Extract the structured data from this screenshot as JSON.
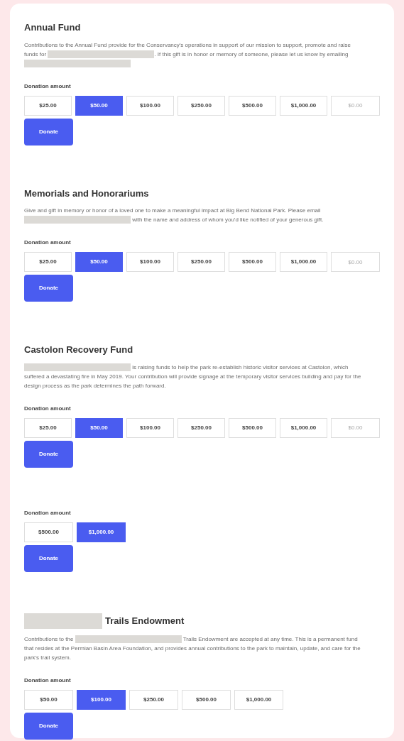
{
  "sections": [
    {
      "title": [
        {
          "kind": "text",
          "text": "Annual Fund"
        }
      ],
      "description": [
        {
          "kind": "text",
          "text": "Contributions to the Annual Fund provide for the Conservancy's operations in support of our mission to support, promote and raise funds for "
        },
        {
          "kind": "redacted"
        },
        {
          "kind": "text",
          "text": ". If this gift is in honor or memory of someone, please let us know by emailing"
        },
        {
          "kind": "redacted"
        }
      ],
      "amount_label": "Donation amount",
      "amounts": [
        {
          "label": "$25.00",
          "selected": false
        },
        {
          "label": "$50.00",
          "selected": true
        },
        {
          "label": "$100.00",
          "selected": false
        },
        {
          "label": "$250.00",
          "selected": false
        },
        {
          "label": "$500.00",
          "selected": false
        },
        {
          "label": "$1,000.00",
          "selected": false
        }
      ],
      "other_amount": {
        "placeholder": "$0.00"
      },
      "donate_button": "Donate"
    },
    {
      "title": [
        {
          "kind": "text",
          "text": "Memorials and Honorariums"
        }
      ],
      "description": [
        {
          "kind": "text",
          "text": "Give and gift in memory or honor of a loved one to make a meaningful impact at Big Bend National Park. Please email "
        },
        {
          "kind": "redacted"
        },
        {
          "kind": "text",
          "text": " with the name and address of whom you'd like notified of your generous gift."
        }
      ],
      "amount_label": "Donation amount",
      "amounts": [
        {
          "label": "$25.00",
          "selected": false
        },
        {
          "label": "$50.00",
          "selected": true
        },
        {
          "label": "$100.00",
          "selected": false
        },
        {
          "label": "$250.00",
          "selected": false
        },
        {
          "label": "$500.00",
          "selected": false
        },
        {
          "label": "$1,000.00",
          "selected": false
        }
      ],
      "other_amount": {
        "placeholder": "$0.00"
      },
      "donate_button": "Donate"
    },
    {
      "title": [
        {
          "kind": "text",
          "text": "Castolon Recovery Fund"
        }
      ],
      "description": [
        {
          "kind": "redacted"
        },
        {
          "kind": "text",
          "text": " is raising funds to help the park re-establish historic visitor services at Castolon, which suffered a devastating fire in May 2019. Your contribution will provide signage at the temporary visitor services building and pay for the design process as the park determines the path forward."
        }
      ],
      "amount_label": "Donation amount",
      "amounts": [
        {
          "label": "$25.00",
          "selected": false
        },
        {
          "label": "$50.00",
          "selected": true
        },
        {
          "label": "$100.00",
          "selected": false
        },
        {
          "label": "$250.00",
          "selected": false
        },
        {
          "label": "$500.00",
          "selected": false
        },
        {
          "label": "$1,000.00",
          "selected": false
        }
      ],
      "other_amount": {
        "placeholder": "$0.00"
      },
      "donate_button": "Donate"
    },
    {
      "amount_label": "Donation amount",
      "amounts": [
        {
          "label": "$500.00",
          "selected": false
        },
        {
          "label": "$1,000.00",
          "selected": true
        }
      ],
      "donate_button": "Donate"
    },
    {
      "title": [
        {
          "kind": "redacted"
        },
        {
          "kind": "text",
          "text": "Trails Endowment"
        }
      ],
      "description": [
        {
          "kind": "text",
          "text": "Contributions to the "
        },
        {
          "kind": "redacted"
        },
        {
          "kind": "text",
          "text": " Trails Endowment are accepted at any time. This is a permanent fund that resides at the Permian Basin Area Foundation, and provides annual contributions to the park to maintain, update, and care for the park's trail system."
        }
      ],
      "amount_label": "Donation amount",
      "amounts": [
        {
          "label": "$50.00",
          "selected": false
        },
        {
          "label": "$100.00",
          "selected": true
        },
        {
          "label": "$250.00",
          "selected": false
        },
        {
          "label": "$500.00",
          "selected": false
        },
        {
          "label": "$1,000.00",
          "selected": false
        }
      ],
      "donate_button": "Donate"
    }
  ]
}
